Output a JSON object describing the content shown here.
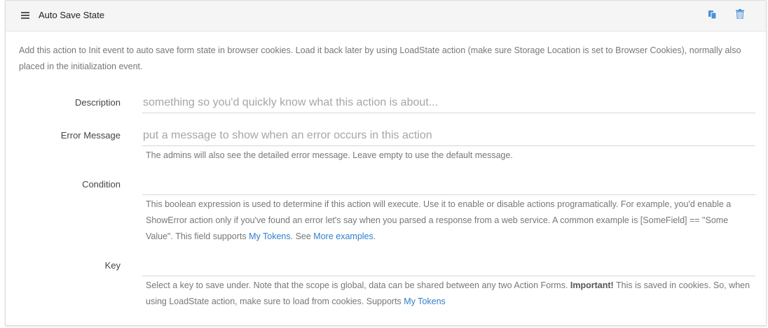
{
  "header": {
    "title": "Auto Save State",
    "drag_icon": "hamburger-lines-icon",
    "copy_icon": "copy-documents-icon",
    "delete_icon": "trash-icon",
    "icon_color": "#4a90d9"
  },
  "intro": {
    "text": "Add this action to Init event to auto save form state in browser cookies. Load it back later by using LoadState action (make sure Storage Location is set to Browser Cookies), normally also placed in the initialization event."
  },
  "fields": {
    "description": {
      "label": "Description",
      "value": "",
      "placeholder": "something so you'd quickly know what this action is about..."
    },
    "error_message": {
      "label": "Error Message",
      "value": "",
      "placeholder": "put a message to show when an error occurs in this action",
      "help": "The admins will also see the detailed error message. Leave empty to use the default message."
    },
    "condition": {
      "label": "Condition",
      "value": "",
      "placeholder": "",
      "help_before": "This boolean expression is used to determine if this action will execute. Use it to enable or disable actions programatically. For example, you'd enable a ShowError action only if you've found an error let's say when you parsed a response from a web service. A common example is [SomeField] == \"Some Value\". This field supports ",
      "help_link1": "My Tokens",
      "help_middle": ". See ",
      "help_link2": "More examples",
      "help_after": "."
    },
    "key": {
      "label": "Key",
      "value": "",
      "placeholder": "",
      "help_before": "Select a key to save under. Note that the scope is global, data can be shared between any two Action Forms. ",
      "help_bold": "Important!",
      "help_middle": " This is saved in cookies. So, when using LoadState action, make sure to load from cookies. Supports ",
      "help_link": "My Tokens"
    }
  },
  "colors": {
    "link": "#2f7fc9",
    "header_bg": "#f5f5f5"
  }
}
